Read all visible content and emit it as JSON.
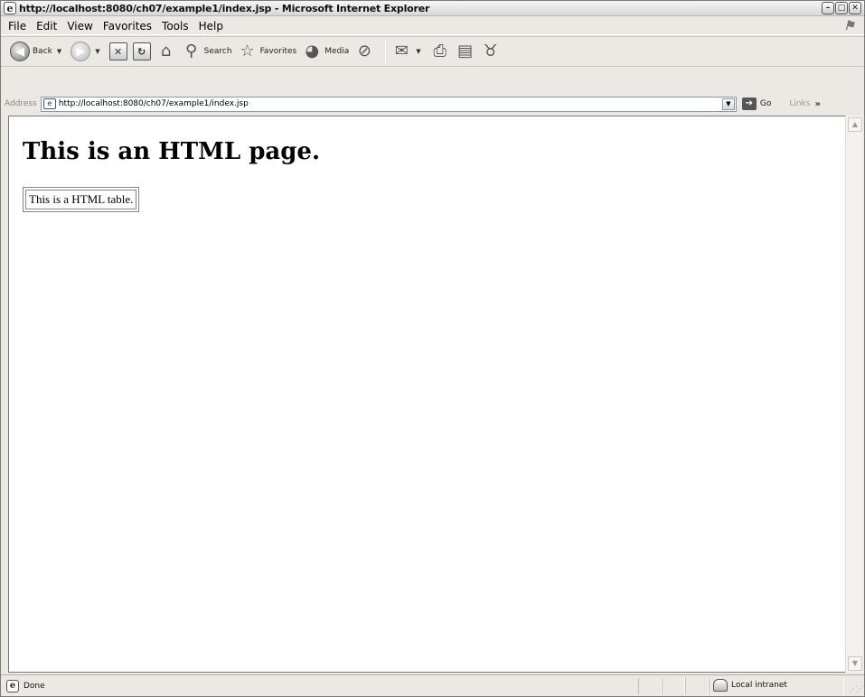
{
  "window": {
    "title": "http://localhost:8080/ch07/example1/index.jsp - Microsoft Internet Explorer"
  },
  "menu": [
    "File",
    "Edit",
    "View",
    "Favorites",
    "Tools",
    "Help"
  ],
  "toolbar": {
    "back_label": "Back",
    "search_label": "Search",
    "favorites_label": "Favorites",
    "media_label": "Media"
  },
  "address": {
    "label": "Address",
    "url": "http://localhost:8080/ch07/example1/index.jsp",
    "go_label": "Go",
    "links_label": "Links",
    "links_more": "»"
  },
  "page": {
    "heading": "This is an HTML page.",
    "table_cell": "This is a HTML table."
  },
  "status": {
    "text": "Done",
    "zone": "Local intranet"
  }
}
